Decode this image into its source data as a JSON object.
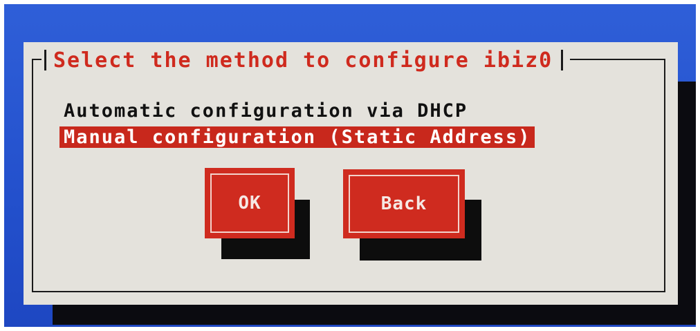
{
  "dialog": {
    "title": "Select the method to configure ibiz0",
    "options": [
      {
        "label": "Automatic configuration via DHCP",
        "selected": false
      },
      {
        "label": "Manual configuration (Static Address)",
        "selected": true
      }
    ],
    "buttons": {
      "ok_label": "OK",
      "back_label": "Back"
    }
  },
  "colors": {
    "screen_background": "#2350cc",
    "dialog_background": "#e4e2dc",
    "accent_red": "#cf2b1f",
    "shadow": "#0d0d0d"
  }
}
